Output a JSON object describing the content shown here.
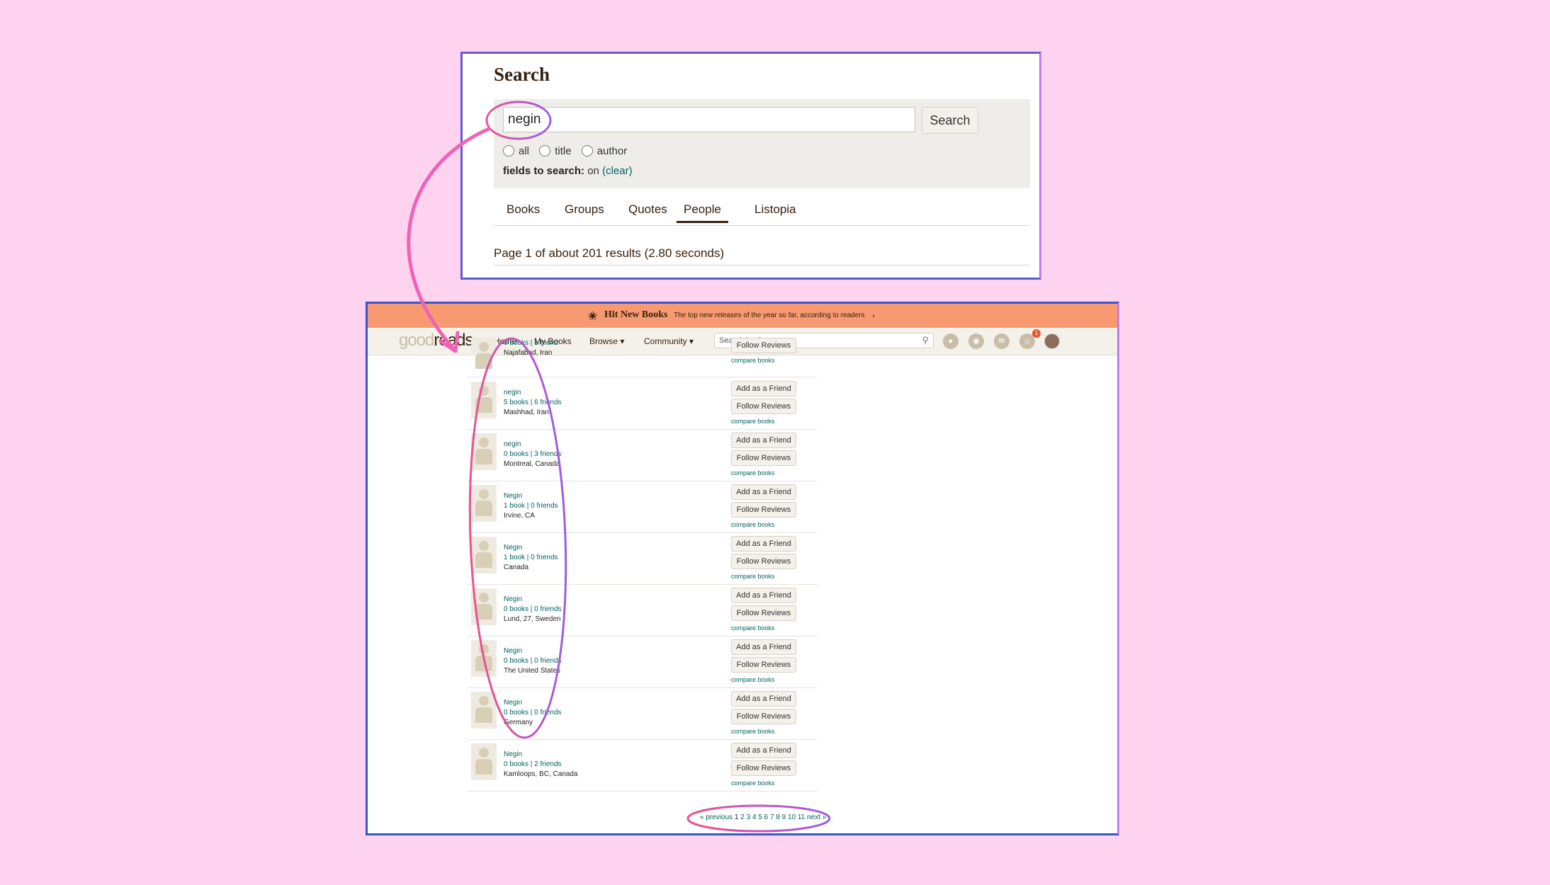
{
  "search_panel": {
    "title": "Search",
    "query": "negin",
    "search_button": "Search",
    "radio_options": [
      "all",
      "title",
      "author"
    ],
    "fields_label": "fields to search:",
    "fields_value": "on",
    "clear_link": "(clear)",
    "tabs": [
      "Books",
      "Groups",
      "Quotes",
      "People",
      "Listopia"
    ],
    "active_tab": "People",
    "results_summary": "Page 1 of about 201 results (2.80 seconds)"
  },
  "banner": {
    "title": "Hit New Books",
    "subtitle": "The top new releases of the year so far, according to readers"
  },
  "navbar": {
    "logo_light": "good",
    "logo_dark": "reads",
    "links": [
      "Home",
      "My Books",
      "Browse ▾",
      "Community ▾"
    ],
    "search_placeholder": "Search books",
    "notification_count": "1"
  },
  "people": [
    {
      "name": "",
      "counts": "0 books | 1 friend",
      "location": "Najafabad, Iran",
      "add_friend": "",
      "follow": "Follow Reviews",
      "compare": "compare books"
    },
    {
      "name": "negin",
      "counts": "5 books | 6 friends",
      "location": "Mashhad, Iran",
      "add_friend": "Add as a Friend",
      "follow": "Follow Reviews",
      "compare": "compare books"
    },
    {
      "name": "negin",
      "counts": "0 books | 3 friends",
      "location": "Montreal, Canada",
      "add_friend": "Add as a Friend",
      "follow": "Follow Reviews",
      "compare": "compare books"
    },
    {
      "name": "Negin",
      "counts": "1 book | 0 friends",
      "location": "Irvine, CA",
      "add_friend": "Add as a Friend",
      "follow": "Follow Reviews",
      "compare": "compare books"
    },
    {
      "name": "Negin",
      "counts": "1 book | 0 friends",
      "location": "Canada",
      "add_friend": "Add as a Friend",
      "follow": "Follow Reviews",
      "compare": "compare books"
    },
    {
      "name": "Negin",
      "counts": "0 books | 0 friends",
      "location": "Lund, 27, Sweden",
      "add_friend": "Add as a Friend",
      "follow": "Follow Reviews",
      "compare": "compare books"
    },
    {
      "name": "Negin",
      "counts": "0 books | 0 friends",
      "location": "The United States",
      "add_friend": "Add as a Friend",
      "follow": "Follow Reviews",
      "compare": "compare books"
    },
    {
      "name": "Negin",
      "counts": "0 books | 0 friends",
      "location": "Germany",
      "add_friend": "Add as a Friend",
      "follow": "Follow Reviews",
      "compare": "compare books"
    },
    {
      "name": "Negin",
      "counts": "0 books | 2 friends",
      "location": "Kamloops, BC, Canada",
      "add_friend": "Add as a Friend",
      "follow": "Follow Reviews",
      "compare": "compare books"
    }
  ],
  "pagination": {
    "previous": "« previous",
    "current": "1",
    "pages": [
      "2",
      "3",
      "4",
      "5",
      "6",
      "7",
      "8",
      "9",
      "10",
      "11"
    ],
    "next": "next »"
  },
  "colors": {
    "background": "#fdd3ef",
    "banner": "#f79a72",
    "link_teal": "#00635d",
    "annotation_pink": "#f062b8",
    "annotation_purple": "#9b5de5"
  }
}
